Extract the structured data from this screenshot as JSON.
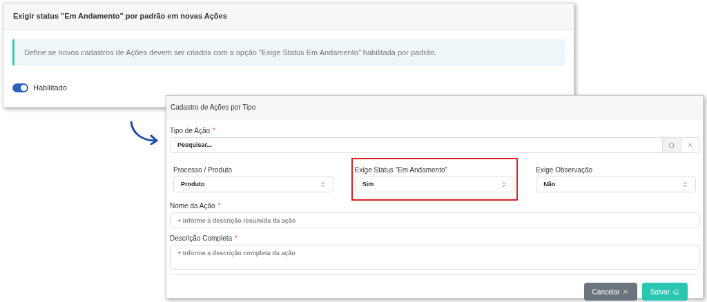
{
  "setting_panel": {
    "title": "Exigir status \"Em Andamento\" por padrão em novas Ações",
    "info": "Define se novos cadastros de Ações devem ser criados com a opção \"Exige Status Em Andamento\" habilitada por padrão.",
    "toggle": {
      "label": "Habilitado",
      "on": true
    }
  },
  "form_window": {
    "title": "Cadastro de Ações por Tipo",
    "tipo_acao": {
      "label": "Tipo de Ação",
      "required_mark": "*",
      "value": "Pesquisar..."
    },
    "selects": [
      {
        "label": "Processo / Produto",
        "value": "Produto",
        "highlighted": false
      },
      {
        "label": "Exige Status \"Em Andamento\"",
        "value": "Sim",
        "highlighted": true
      },
      {
        "label": "Exige Observação",
        "value": "Não",
        "highlighted": false
      }
    ],
    "nome": {
      "label": "Nome da Ação",
      "required_mark": "*",
      "placeholder": "+ Informe a descrição resumida da ação"
    },
    "descricao": {
      "label": "Descrição Completa",
      "required_mark": "*",
      "placeholder": "+ Informe a descrição completa da ação"
    },
    "buttons": [
      {
        "label": "Cancelar",
        "kind": "cancel"
      },
      {
        "label": "Salvar",
        "kind": "save"
      }
    ]
  }
}
